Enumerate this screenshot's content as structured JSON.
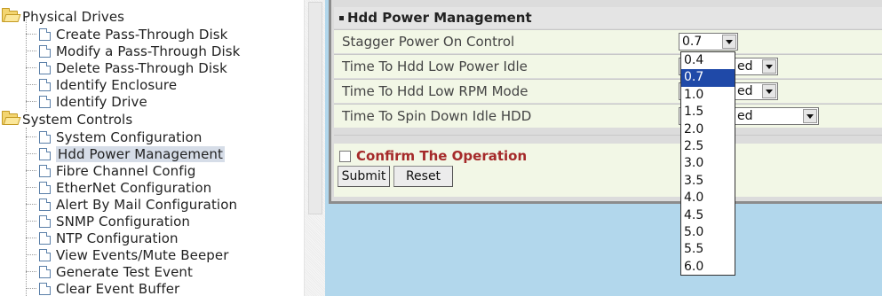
{
  "tree": {
    "top_fragment": "",
    "groups": [
      {
        "label": "Physical Drives",
        "items": [
          "Create Pass-Through Disk",
          "Modify a Pass-Through Disk",
          "Delete Pass-Through Disk",
          "Identify Enclosure",
          "Identify Drive"
        ]
      },
      {
        "label": "System Controls",
        "items": [
          "System Configuration",
          "Hdd Power Management",
          "Fibre Channel Config",
          "EtherNet Configuration",
          "Alert By Mail Configuration",
          "SNMP Configuration",
          "NTP Configuration",
          "View Events/Mute Beeper",
          "Generate Test Event",
          "Clear Event Buffer"
        ]
      }
    ],
    "selected_item": "Hdd Power Management"
  },
  "panel": {
    "title": "Hdd Power Management",
    "rows": [
      {
        "label": "Stagger Power On Control",
        "value": "0.7"
      },
      {
        "label": "Time To Hdd Low Power Idle",
        "value": "ed"
      },
      {
        "label": "Time To Hdd Low RPM Mode",
        "value": "ed"
      },
      {
        "label": "Time To Spin Down Idle HDD",
        "value": "ed"
      }
    ],
    "confirm_label": "Confirm The Operation",
    "submit_label": "Submit",
    "reset_label": "Reset"
  },
  "dropdown": {
    "options": [
      "0.4",
      "0.7",
      "1.0",
      "1.5",
      "2.0",
      "2.5",
      "3.0",
      "3.5",
      "4.0",
      "4.5",
      "5.0",
      "5.5",
      "6.0"
    ],
    "selected": "0.7"
  },
  "colors": {
    "content_bg": "#b2d7ec",
    "row_bg": "#f2f7e6",
    "confirm_text": "#a52a2a",
    "selected_option": "#1f49a8"
  }
}
